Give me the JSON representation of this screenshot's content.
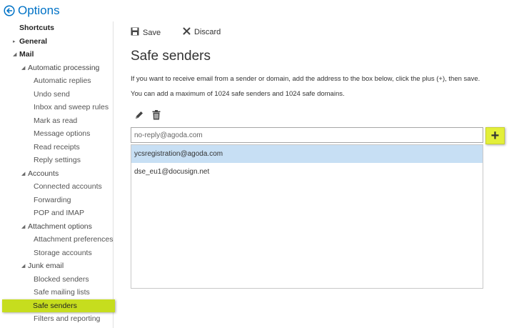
{
  "header": {
    "title": "Options"
  },
  "sidebar": {
    "items": [
      {
        "label": "Shortcuts",
        "level": 0,
        "expander": ""
      },
      {
        "label": "General",
        "level": 0,
        "expander": "▸"
      },
      {
        "label": "Mail",
        "level": 0,
        "expander": "◢"
      },
      {
        "label": "Automatic processing",
        "level": 1,
        "expander": "◢"
      },
      {
        "label": "Automatic replies",
        "level": 2,
        "expander": ""
      },
      {
        "label": "Undo send",
        "level": 2,
        "expander": ""
      },
      {
        "label": "Inbox and sweep rules",
        "level": 2,
        "expander": ""
      },
      {
        "label": "Mark as read",
        "level": 2,
        "expander": ""
      },
      {
        "label": "Message options",
        "level": 2,
        "expander": ""
      },
      {
        "label": "Read receipts",
        "level": 2,
        "expander": ""
      },
      {
        "label": "Reply settings",
        "level": 2,
        "expander": ""
      },
      {
        "label": "Accounts",
        "level": 1,
        "expander": "◢"
      },
      {
        "label": "Connected accounts",
        "level": 2,
        "expander": ""
      },
      {
        "label": "Forwarding",
        "level": 2,
        "expander": ""
      },
      {
        "label": "POP and IMAP",
        "level": 2,
        "expander": ""
      },
      {
        "label": "Attachment options",
        "level": 1,
        "expander": "◢"
      },
      {
        "label": "Attachment preferences",
        "level": 2,
        "expander": ""
      },
      {
        "label": "Storage accounts",
        "level": 2,
        "expander": ""
      },
      {
        "label": "Junk email",
        "level": 1,
        "expander": "◢"
      },
      {
        "label": "Blocked senders",
        "level": 2,
        "expander": ""
      },
      {
        "label": "Safe mailing lists",
        "level": 2,
        "expander": ""
      },
      {
        "label": "Safe senders",
        "level": 2,
        "expander": "",
        "selected": true
      },
      {
        "label": "Filters and reporting",
        "level": 2,
        "expander": ""
      }
    ]
  },
  "toolbar": {
    "save_label": "Save",
    "discard_label": "Discard"
  },
  "main": {
    "title": "Safe senders",
    "description_1": "If you want to receive email from a sender or domain, add the address to the box below, click the plus (+), then save.",
    "description_2": "You can add a maximum of 1024 safe senders and 1024 safe domains.",
    "input_value": "no-reply@agoda.com",
    "add_label": "+",
    "list": [
      {
        "text": "ycsregistration@agoda.com",
        "selected": true
      },
      {
        "text": "dse_eu1@docusign.net",
        "selected": false
      }
    ]
  },
  "colors": {
    "accent": "#0072c6",
    "highlight": "#c6dd1e",
    "plus_button": "#e3ef3a",
    "selected_row": "#c7dff4"
  },
  "icons": {
    "back": "back-arrow-circle-icon",
    "save": "floppy-disk-icon",
    "discard": "x-close-icon",
    "edit": "pencil-icon",
    "delete": "trash-icon"
  }
}
